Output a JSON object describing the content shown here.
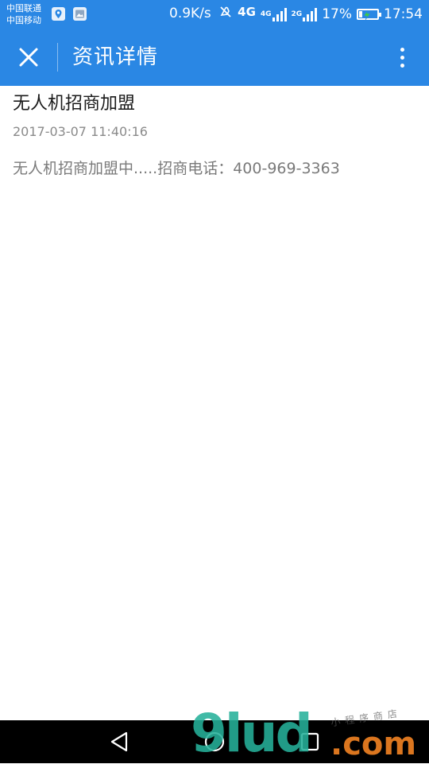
{
  "status_bar": {
    "carrier_1": "中国联通",
    "carrier_2": "中国移动",
    "net_speed": "0.9K/s",
    "net_4g": "4G",
    "net_4g_small": "4G",
    "net_2g_small": "2G",
    "battery_percent": "17%",
    "battery_level": 0.17,
    "time": "17:54",
    "icons": [
      "location-app-icon",
      "gallery-app-icon",
      "mute-icon",
      "signal-icon",
      "signal-icon",
      "battery-charging-icon"
    ]
  },
  "app_bar": {
    "title": "资讯详情",
    "close_icon": "close-icon",
    "more_icon": "more-vertical-icon",
    "background": "#2a87e4"
  },
  "article": {
    "title": "无人机招商加盟",
    "date": "2017-03-07 11:40:16",
    "body": "无人机招商加盟中.....招商电话：400-969-3363"
  },
  "nav_bar": {
    "icons": [
      "back-triangle-icon",
      "home-circle-icon",
      "recents-square-icon"
    ]
  },
  "watermark": {
    "logo": "9lud",
    "domain": ".com",
    "tag": "小程序商店"
  }
}
